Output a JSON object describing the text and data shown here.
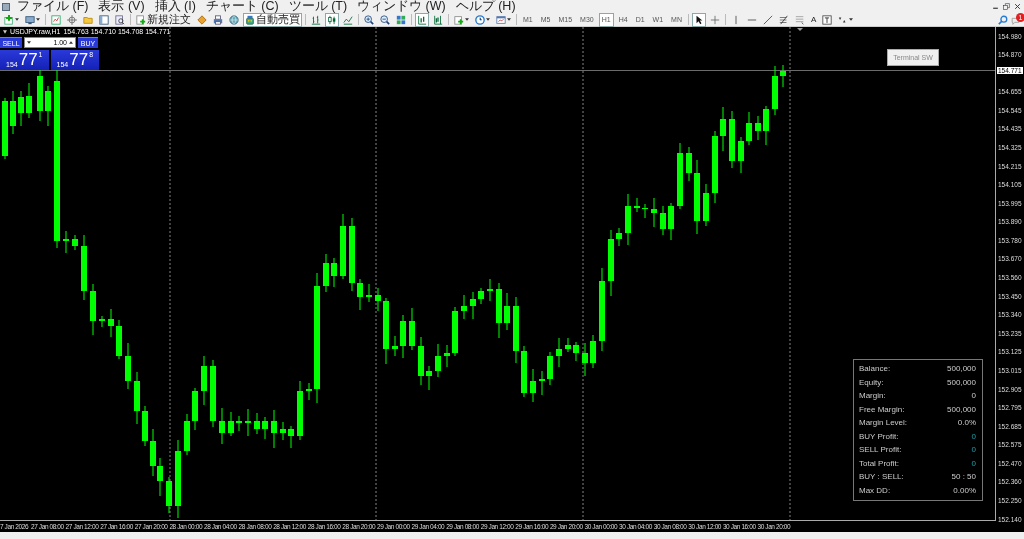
{
  "menu": [
    "ファイル (F)",
    "表示 (V)",
    "挿入 (I)",
    "チャート (C)",
    "ツール (T)",
    "ウィンドウ (W)",
    "ヘルプ (H)"
  ],
  "toolbar": {
    "items": [
      {
        "kind": "new-chart",
        "selected": false
      },
      {
        "kind": "profiles",
        "selected": false
      },
      {
        "kind": "separator"
      },
      {
        "kind": "market-watch",
        "selected": false
      },
      {
        "kind": "data-window",
        "selected": false
      },
      {
        "kind": "navigator",
        "selected": false
      },
      {
        "kind": "terminal",
        "selected": false
      },
      {
        "kind": "tester",
        "selected": false
      },
      {
        "kind": "separator"
      },
      {
        "kind": "order",
        "label": "新規注文",
        "selected": false
      },
      {
        "kind": "editor",
        "selected": false
      },
      {
        "kind": "print",
        "selected": false
      },
      {
        "kind": "globe",
        "selected": false
      },
      {
        "kind": "autotrade",
        "label": "自動売買",
        "selected": true
      },
      {
        "kind": "separator"
      },
      {
        "kind": "bar-chart",
        "selected": false
      },
      {
        "kind": "candles",
        "selected": true
      },
      {
        "kind": "line-chart",
        "selected": false
      },
      {
        "kind": "separator"
      },
      {
        "kind": "zoom-in",
        "selected": false
      },
      {
        "kind": "zoom-out",
        "selected": false
      },
      {
        "kind": "tile",
        "selected": false
      },
      {
        "kind": "separator"
      },
      {
        "kind": "autoscroll",
        "selected": true
      },
      {
        "kind": "shift",
        "selected": false
      },
      {
        "kind": "separator"
      },
      {
        "kind": "indicators",
        "selected": false
      },
      {
        "kind": "periods",
        "selected": false
      },
      {
        "kind": "templates",
        "selected": false
      },
      {
        "kind": "separator"
      },
      {
        "kind": "timeframe",
        "label": "M1",
        "selected": false
      },
      {
        "kind": "timeframe",
        "label": "M5",
        "selected": false
      },
      {
        "kind": "timeframe",
        "label": "M15",
        "selected": false
      },
      {
        "kind": "timeframe",
        "label": "M30",
        "selected": false
      },
      {
        "kind": "timeframe",
        "label": "H1",
        "selected": true
      },
      {
        "kind": "timeframe",
        "label": "H4",
        "selected": false
      },
      {
        "kind": "timeframe",
        "label": "D1",
        "selected": false
      },
      {
        "kind": "timeframe",
        "label": "W1",
        "selected": false
      },
      {
        "kind": "timeframe",
        "label": "MN",
        "selected": false
      },
      {
        "kind": "separator"
      },
      {
        "kind": "cursor",
        "selected": true
      },
      {
        "kind": "crosshair",
        "selected": false
      },
      {
        "kind": "separator"
      },
      {
        "kind": "vline",
        "selected": false
      },
      {
        "kind": "hline",
        "selected": false
      },
      {
        "kind": "trendline",
        "selected": false
      },
      {
        "kind": "fibo",
        "selected": false
      },
      {
        "kind": "channel",
        "selected": false
      },
      {
        "kind": "text",
        "label": "A",
        "selected": false
      },
      {
        "kind": "label",
        "selected": false
      },
      {
        "kind": "arrows",
        "selected": false
      }
    ],
    "notifications": "1"
  },
  "chart": {
    "symbol": "USDJPY.raw,H1",
    "quotes": [
      "154.763",
      "154.710",
      "154.708",
      "154.771"
    ],
    "trade_panel": {
      "sell_label": "SELL",
      "lot": "1.00",
      "buy_label": "BUY",
      "sell_price": {
        "big_figure": "154",
        "pips": "77",
        "point": "1"
      },
      "buy_price": {
        "big_figure": "154",
        "pips": "77",
        "point": "8"
      }
    },
    "terminal_button": "Terminal SW",
    "current_price": "154.771",
    "price_axis": [
      "154.980",
      "154.870",
      "154.655",
      "154.545",
      "154.435",
      "154.325",
      "154.215",
      "154.105",
      "153.995",
      "153.890",
      "153.780",
      "153.670",
      "153.560",
      "153.450",
      "153.340",
      "153.235",
      "153.125",
      "153.015",
      "152.905",
      "152.795",
      "152.685",
      "152.575",
      "152.470",
      "152.360",
      "152.250",
      "152.140"
    ],
    "time_axis": [
      "7 Jan 2026",
      "27 Jan 08:00",
      "27 Jan 12:00",
      "27 Jan 16:00",
      "27 Jan 20:00",
      "28 Jan 00:00",
      "28 Jan 04:00",
      "28 Jan 08:00",
      "28 Jan 12:00",
      "28 Jan 16:00",
      "28 Jan 20:00",
      "29 Jan 00:00",
      "29 Jan 04:00",
      "29 Jan 08:00",
      "29 Jan 12:00",
      "29 Jan 16:00",
      "29 Jan 20:00",
      "30 Jan 00:00",
      "30 Jan 04:00",
      "30 Jan 08:00",
      "30 Jan 12:00",
      "30 Jan 16:00",
      "30 Jan 20:00"
    ],
    "account": [
      {
        "label": "Balance:",
        "value": "500,000",
        "kind": "plain"
      },
      {
        "label": "Equity:",
        "value": "500,000",
        "kind": "plain"
      },
      {
        "label": "Margin:",
        "value": "0",
        "kind": "plain"
      },
      {
        "label": "Free Margin:",
        "value": "500,000",
        "kind": "plain"
      },
      {
        "label": "Margin Level:",
        "value": "0.0%",
        "kind": "plain"
      },
      {
        "label": "BUY Profit:",
        "value": "0",
        "kind": "profit"
      },
      {
        "label": "SELL Profit:",
        "value": "0",
        "kind": "profit"
      },
      {
        "label": "Total Profit:",
        "value": "0",
        "kind": "profit"
      },
      {
        "label": "BUY : SELL:",
        "value": "50 : 50",
        "kind": "plain"
      },
      {
        "label": "Max DD:",
        "value": "0.00%",
        "kind": "plain"
      }
    ]
  }
}
